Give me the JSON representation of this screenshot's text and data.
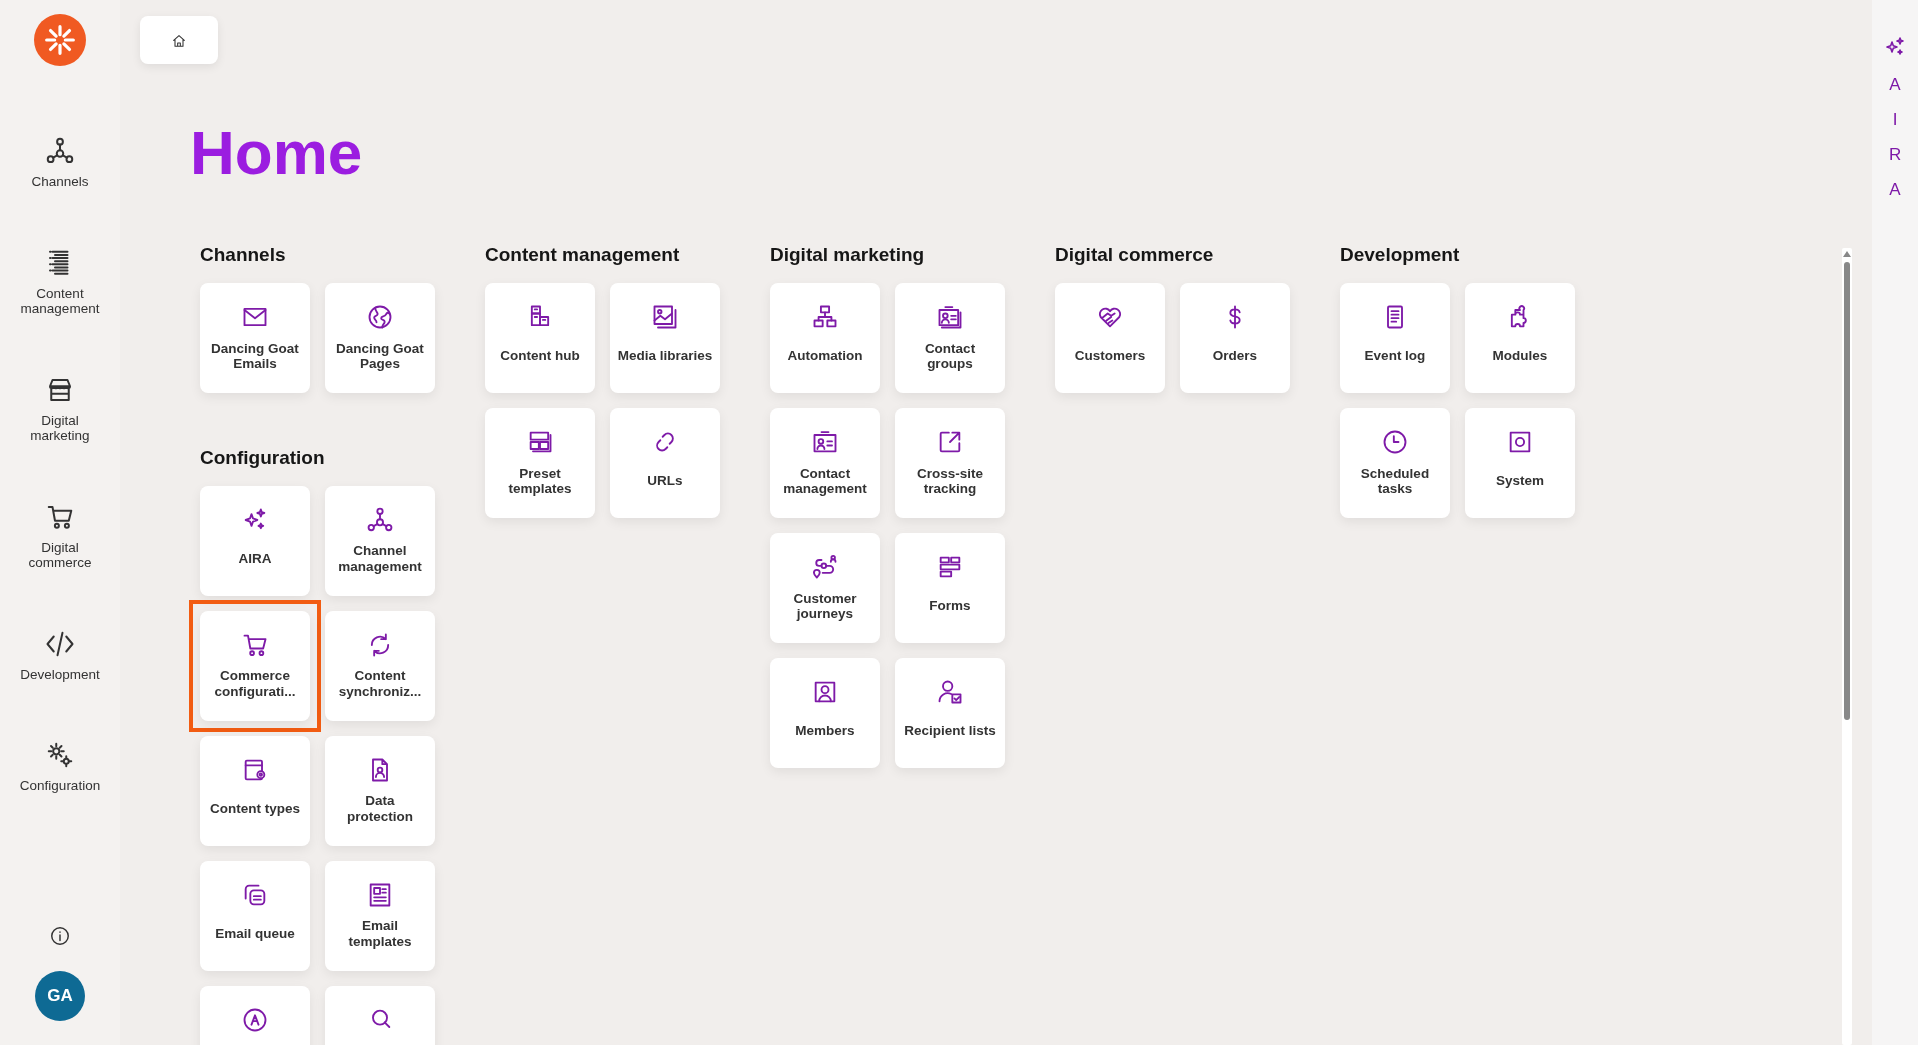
{
  "sidebar": {
    "items": [
      {
        "label": "Channels"
      },
      {
        "label": "Content management"
      },
      {
        "label": "Digital marketing"
      },
      {
        "label": "Digital commerce"
      },
      {
        "label": "Development"
      },
      {
        "label": "Configuration"
      }
    ],
    "avatar": "GA"
  },
  "title": "Home",
  "columns": [
    {
      "sections": [
        {
          "title": "Channels",
          "tiles": [
            {
              "label": "Dancing Goat Emails",
              "highlighted": false
            },
            {
              "label": "Dancing Goat Pages",
              "highlighted": false
            }
          ]
        },
        {
          "title": "Configuration",
          "tiles": [
            {
              "label": "AIRA",
              "highlighted": false
            },
            {
              "label": "Channel management",
              "highlighted": false
            },
            {
              "label": "Commerce configurati...",
              "highlighted": true
            },
            {
              "label": "Content synchroniz...",
              "highlighted": false
            },
            {
              "label": "Content types",
              "highlighted": false
            },
            {
              "label": "Data protection",
              "highlighted": false
            },
            {
              "label": "Email queue",
              "highlighted": false
            },
            {
              "label": "Email templates",
              "highlighted": false
            },
            {
              "highlighted": false
            },
            {
              "highlighted": false
            }
          ]
        }
      ]
    },
    {
      "sections": [
        {
          "title": "Content management",
          "tiles": [
            {
              "label": "Content hub"
            },
            {
              "label": "Media libraries"
            },
            {
              "label": "Preset templates"
            },
            {
              "label": "URLs"
            }
          ]
        }
      ]
    },
    {
      "sections": [
        {
          "title": "Digital marketing",
          "tiles": [
            {
              "label": "Automation"
            },
            {
              "label": "Contact groups"
            },
            {
              "label": "Contact management"
            },
            {
              "label": "Cross-site tracking"
            },
            {
              "label": "Customer journeys"
            },
            {
              "label": "Forms"
            },
            {
              "label": "Members"
            },
            {
              "label": "Recipient lists"
            }
          ]
        }
      ]
    },
    {
      "sections": [
        {
          "title": "Digital commerce",
          "tiles": [
            {
              "label": "Customers"
            },
            {
              "label": "Orders"
            }
          ]
        }
      ]
    },
    {
      "sections": [
        {
          "title": "Development",
          "tiles": [
            {
              "label": "Event log"
            },
            {
              "label": "Modules"
            },
            {
              "label": "Scheduled tasks"
            },
            {
              "label": "System"
            }
          ]
        }
      ]
    }
  ],
  "aira_panel": {
    "label": "AIRA"
  }
}
